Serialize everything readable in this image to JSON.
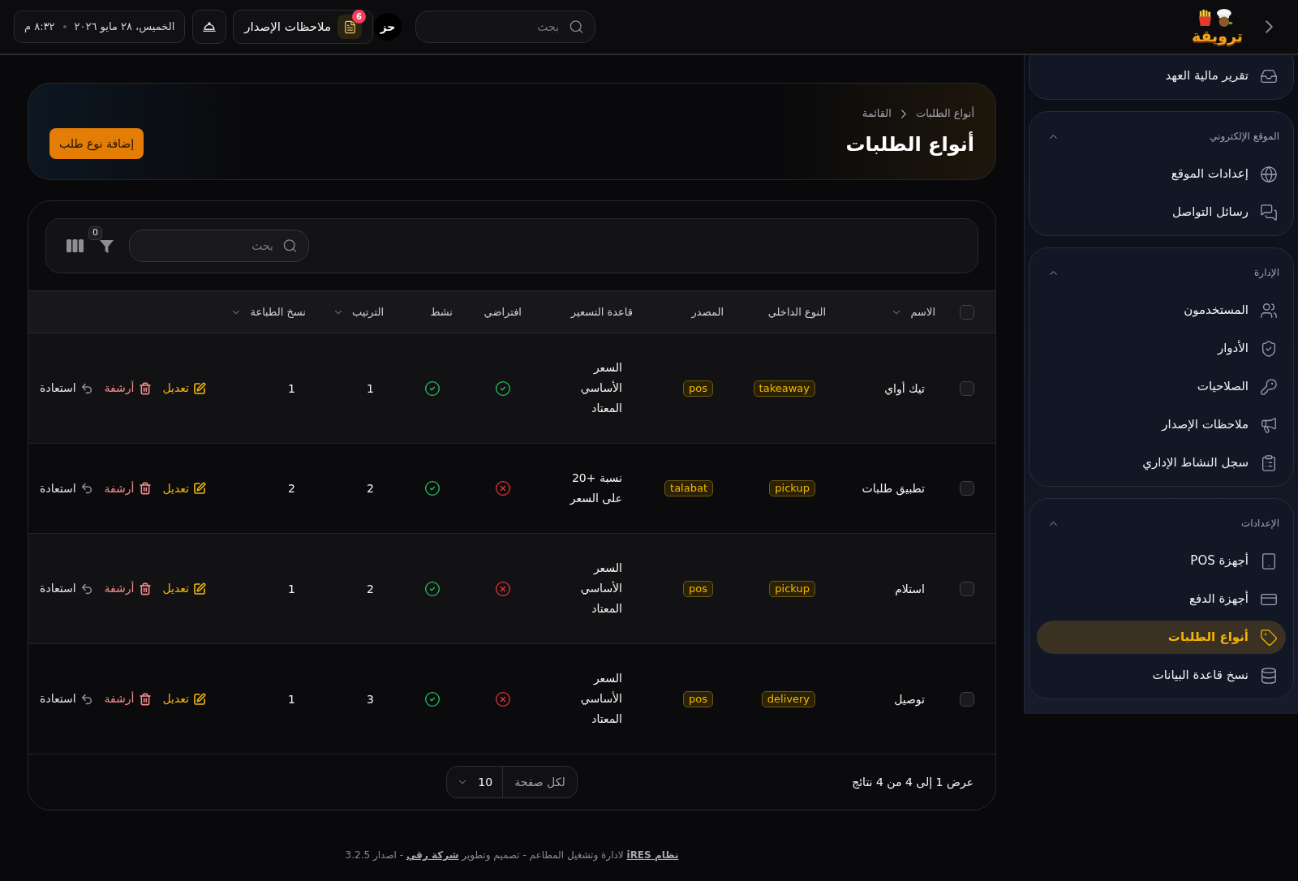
{
  "top_bar": {
    "logo": {
      "text": "ترويقة"
    },
    "search": {
      "placeholder": "بحث"
    },
    "user": {
      "initials": "حز"
    },
    "release_notes": {
      "label": "ملاحظات الإصدار",
      "badge": "6"
    },
    "datetime": {
      "date": "الخميس، ٢٨ مايو ٢٠٢٦",
      "time": "٨:٣٢ م"
    }
  },
  "sidebar": {
    "sections": [
      {
        "items": [
          {
            "label": "تقرير مالية العهد",
            "selected": false
          }
        ]
      },
      {
        "title": "الموقع الإلكتروني",
        "expanded": true,
        "items": [
          {
            "label": "إعدادات الموقع",
            "selected": false
          },
          {
            "label": "رسائل التواصل",
            "selected": false
          }
        ]
      },
      {
        "title": "الإدارة",
        "expanded": true,
        "items": [
          {
            "label": "المستخدمون",
            "selected": false
          },
          {
            "label": "الأدوار",
            "selected": false
          },
          {
            "label": "الصلاحيات",
            "selected": false
          },
          {
            "label": "ملاحظات الإصدار",
            "selected": false
          },
          {
            "label": "سجل النشاط الإداري",
            "selected": false
          }
        ]
      },
      {
        "title": "الإعدادات",
        "expanded": true,
        "items": [
          {
            "label": "أجهزة POS",
            "selected": false
          },
          {
            "label": "أجهزة الدفع",
            "selected": false
          },
          {
            "label": "أنواع الطلبات",
            "selected": true
          },
          {
            "label": "نسخ قاعدة البيانات",
            "selected": false
          }
        ]
      }
    ]
  },
  "page_header": {
    "breadcrumbs": [
      "أنواع الطلبات",
      "القائمة"
    ],
    "title": "أنواع الطلبات",
    "primary_button": "إضافة نوع طلب"
  },
  "table": {
    "toolbar": {
      "search": {
        "placeholder": "بحث"
      },
      "filter_count": "0"
    },
    "select_all": false,
    "columns": [
      {
        "label": "الاسم",
        "sortable": true
      },
      {
        "label": "النوع الداخلي",
        "sortable": false
      },
      {
        "label": "المصدر",
        "sortable": false
      },
      {
        "label": "قاعدة التسعير",
        "sortable": false
      },
      {
        "label": "افتراضي",
        "sortable": false
      },
      {
        "label": "نشط",
        "sortable": false
      },
      {
        "label": "الترتيب",
        "sortable": true
      },
      {
        "label": "نسخ الطباعة",
        "sortable": true
      }
    ],
    "rows": [
      {
        "selected": false,
        "name": "تيك أواي",
        "internal_type": "takeaway",
        "source": "pos",
        "pricing_rule": "السعر الأساسي المعتاد",
        "default": true,
        "active": true,
        "order": "1",
        "print_copies": "1",
        "actions": [
          {
            "kind": "edit",
            "label": "تعديل"
          },
          {
            "kind": "archive",
            "label": "أرشفة"
          },
          {
            "kind": "restore",
            "label": "استعادة"
          }
        ]
      },
      {
        "selected": false,
        "name": "تطبيق طلبات",
        "internal_type": "pickup",
        "source": "talabat",
        "pricing_rule": "نسبة +20 على السعر",
        "default": false,
        "active": true,
        "order": "2",
        "print_copies": "2",
        "actions": [
          {
            "kind": "edit",
            "label": "تعديل"
          },
          {
            "kind": "archive",
            "label": "أرشفة"
          },
          {
            "kind": "restore",
            "label": "استعادة"
          }
        ]
      },
      {
        "selected": false,
        "name": "استلام",
        "internal_type": "pickup",
        "source": "pos",
        "pricing_rule": "السعر الأساسي المعتاد",
        "default": false,
        "active": true,
        "order": "2",
        "print_copies": "1",
        "actions": [
          {
            "kind": "edit",
            "label": "تعديل"
          },
          {
            "kind": "archive",
            "label": "أرشفة"
          },
          {
            "kind": "restore",
            "label": "استعادة"
          }
        ]
      },
      {
        "selected": false,
        "name": "توصيل",
        "internal_type": "delivery",
        "source": "pos",
        "pricing_rule": "السعر الأساسي المعتاد",
        "default": false,
        "active": true,
        "order": "3",
        "print_copies": "1",
        "actions": [
          {
            "kind": "edit",
            "label": "تعديل"
          },
          {
            "kind": "archive",
            "label": "أرشفة"
          },
          {
            "kind": "restore",
            "label": "استعادة"
          }
        ]
      }
    ],
    "footer": {
      "summary": "عرض 1 إلى 4 من 4 نتائج",
      "per_page_label": "لكل صفحة",
      "per_page": "10"
    }
  },
  "page_footer": {
    "parts": [
      {
        "kind": "link",
        "text": "نظام iRES"
      },
      {
        "kind": "text",
        "text": "لادارة وتشغيل المطاعم - تصميم وتطوير"
      },
      {
        "kind": "link",
        "text": "شركة رقي"
      },
      {
        "kind": "text",
        "text": "- اصدار 3.2.5"
      }
    ]
  }
}
